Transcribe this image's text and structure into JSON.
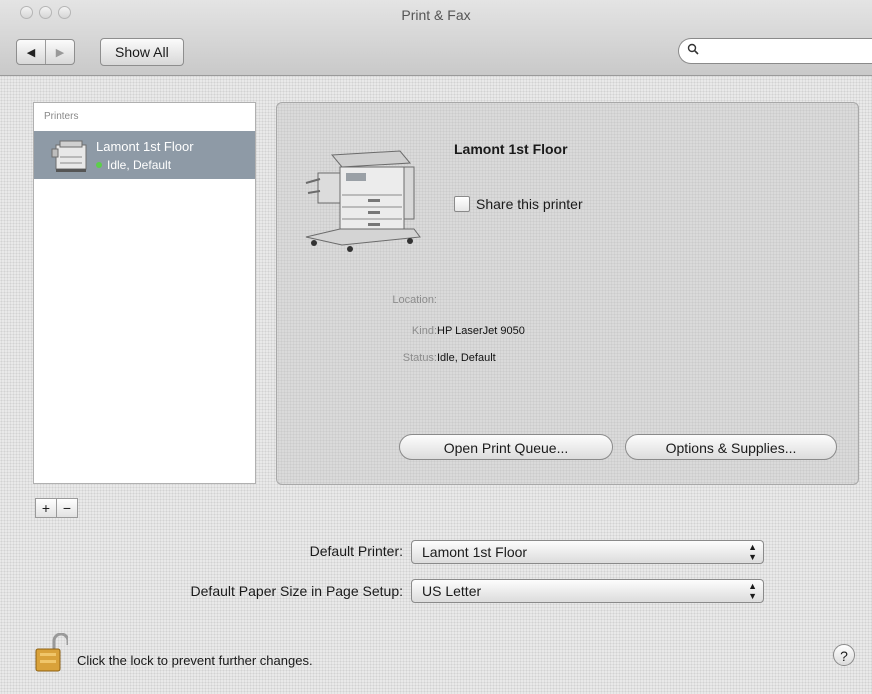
{
  "window": {
    "title": "Print & Fax"
  },
  "toolbar": {
    "back_icon": "◀",
    "forward_icon": "▶",
    "show_all_label": "Show All",
    "search_placeholder": ""
  },
  "printers_list": {
    "header": "Printers",
    "items": [
      {
        "name": "Lamont 1st Floor",
        "status": "Idle, Default",
        "status_color": "#5ccf4a"
      }
    ]
  },
  "detail": {
    "name": "Lamont 1st Floor",
    "share_label": "Share this printer",
    "share_checked": false,
    "location_label": "Location:",
    "location_value": "",
    "kind_label": "Kind:",
    "kind_value": "HP LaserJet 9050",
    "status_label": "Status:",
    "status_value": "Idle, Default",
    "open_queue_label": "Open Print Queue...",
    "options_label": "Options & Supplies..."
  },
  "list_controls": {
    "add_label": "+",
    "remove_label": "−"
  },
  "defaults": {
    "default_printer_label": "Default Printer:",
    "default_printer_value": "Lamont 1st Floor",
    "paper_size_label": "Default Paper Size in Page Setup:",
    "paper_size_value": "US Letter"
  },
  "footer": {
    "lock_text": "Click the lock to prevent further changes.",
    "help_label": "?"
  },
  "colors": {
    "selection": "#8e9aa6",
    "status_dot": "#5ccf4a"
  }
}
